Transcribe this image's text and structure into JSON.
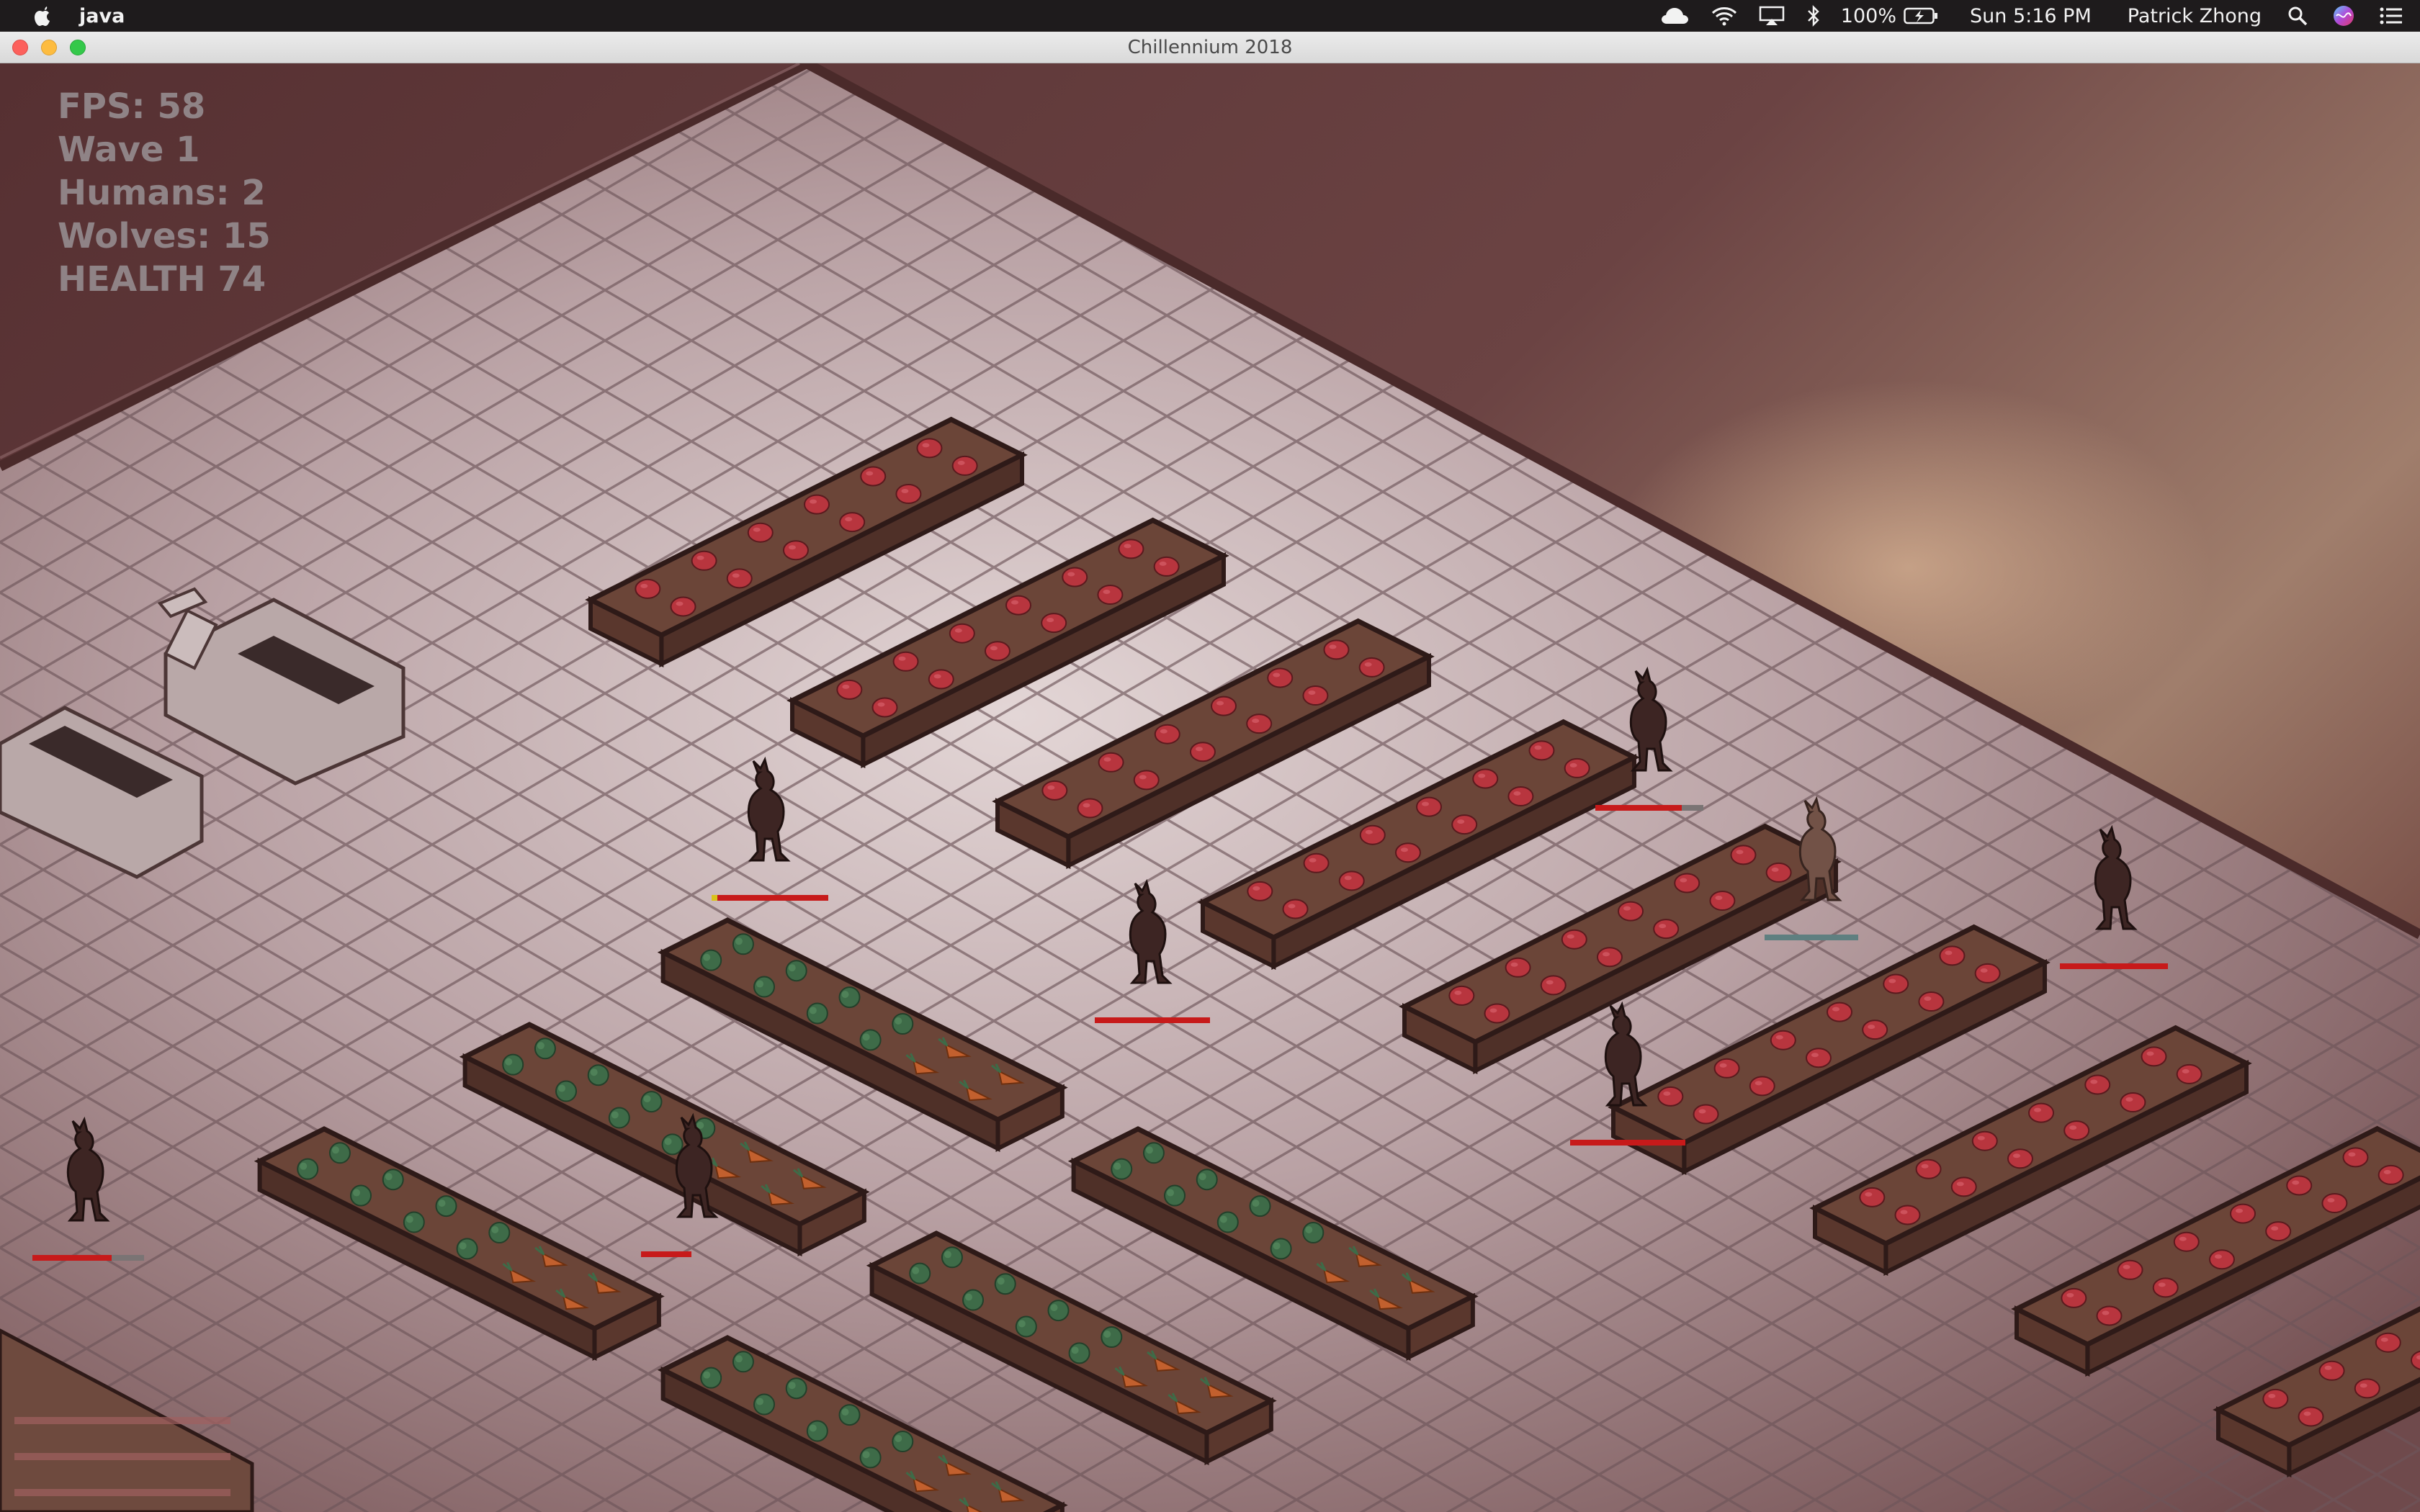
{
  "menubar": {
    "app_name": "java",
    "battery": "100%",
    "clock": "Sun 5:16 PM",
    "user": "Patrick Zhong",
    "icons": [
      "apple-icon",
      "cloud-icon",
      "wifi-icon",
      "airplay-icon",
      "bluetooth-icon",
      "battery-icon",
      "spotlight-icon",
      "siri-icon",
      "notification-center-icon"
    ]
  },
  "window": {
    "title": "Chillennium 2018"
  },
  "hud": {
    "fps": "FPS: 58",
    "wave": "Wave 1",
    "humans": "Humans: 2",
    "wolves": "Wolves: 15",
    "health": "HEALTH 74"
  },
  "colors": {
    "wall_dark": "#5c3436",
    "wall_light": "#8a6258",
    "floor": "#a98f92",
    "floor_light": "#d6c6c6",
    "grid": "#6d5559",
    "crate": "#6b4538",
    "crate_edge": "#2e1a18",
    "tomato": "#b8353e",
    "broccoli": "#3e6b48",
    "carrot": "#c2602e",
    "wolf": "#3d2523",
    "health_red": "#c71a1a",
    "health_gray": "#7a7474",
    "hud_text": "#8f8386"
  }
}
